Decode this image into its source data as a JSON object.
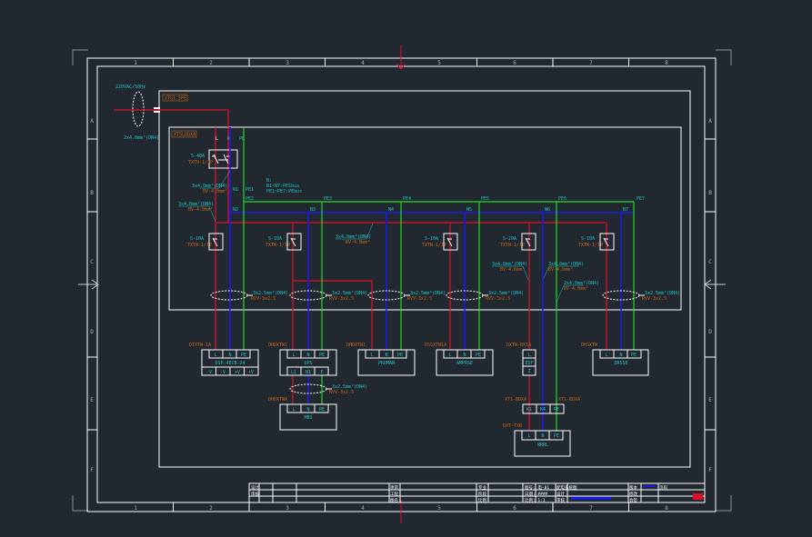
{
  "frame": {
    "columns": [
      "1",
      "2",
      "3",
      "4",
      "5",
      "6",
      "7",
      "8"
    ],
    "rows": [
      "A",
      "B",
      "C",
      "D",
      "E",
      "F"
    ]
  },
  "incoming": {
    "cable_label": "220VAC/50Hz",
    "cable_spec": "2x4.0mm²(DN4)",
    "box_label": "XTS1.5PE",
    "panel_label": "XTSLBDXA"
  },
  "main_switch": {
    "name": "S-40A",
    "spec": "TXTN-1/1P",
    "phase_labels": [
      "L",
      "N",
      "PE"
    ]
  },
  "bus": {
    "note_lines": [
      "N:",
      "N1~N7:PE1bus",
      "PE1~PE7:PEbus"
    ],
    "n_labels": [
      "N1",
      "N2",
      "N3",
      "N4",
      "N5",
      "N6",
      "N7"
    ],
    "pe_labels": [
      "PE1",
      "PE2",
      "PE3",
      "PE4",
      "PE5",
      "PE6",
      "PE7"
    ],
    "wire_notes": [
      {
        "a": "3x4.0mm²(DN4)",
        "b": "BV-4.0mm²"
      },
      {
        "a": "3x4.0mm²(DN4)",
        "b": "BV-4.0mm²"
      },
      {
        "a": "3x4.0mm²(DN4)",
        "b": "BV-4.0mm²"
      },
      {
        "a": "3x4.0mm²(DN4)",
        "b": "BV-4.0mm²"
      },
      {
        "a": "3x4.0mm²(DN4)",
        "b": "BV-4.0mm²"
      },
      {
        "a": "2x4.0mm²(DN4)",
        "b": "BV-4.0mm²"
      }
    ]
  },
  "branches": [
    {
      "breaker": "S-10A",
      "spec": "TXTN-1/1P",
      "cable": "3x2.5mm²(DN4)",
      "cable_spec": "RVV-3x2.5",
      "load": "DTXTN-1A",
      "terminals": [
        "L",
        "N",
        "PE"
      ],
      "device": "DSP-4ECB-24",
      "sub_terminals": [
        "-V",
        "-V",
        "+V",
        "+V"
      ]
    },
    {
      "breaker": "S-10A",
      "spec": "TXTN-1/1P",
      "cable": "3x2.5mm²(DN4)",
      "cable_spec": "RVV-3x2.5",
      "load": "DHDXTN1",
      "terminals": [
        "L",
        "N",
        "PE"
      ],
      "device": "UPS",
      "sub_terminals": [
        "L1",
        "N1",
        "E"
      ]
    },
    {
      "breaker": "",
      "spec": "",
      "cable": "3x2.5mm²(DN4)",
      "cable_spec": "RVV-3x2.5",
      "load": "DHDXTN1",
      "terminals": [
        "L",
        "N",
        "PE"
      ],
      "device": "PROMAN"
    },
    {
      "breaker": "S-10A",
      "spec": "TXTN-1/1P",
      "cable": "3x2.5mm²(DN4)",
      "cable_spec": "RVV-3x2.5",
      "load": "DSSXTN1A",
      "terminals": [
        "L",
        "N",
        "PE"
      ],
      "device": "AMPRSE"
    },
    {
      "breaker": "S-20A",
      "spec": "TXTN-1/1P",
      "load": "DXTN-BX1A",
      "terminals": [
        "L",
        "EDF",
        "Z"
      ],
      "device": ""
    },
    {
      "breaker": "S-10A",
      "spec": "TXTN-1/1P",
      "cable": "3x2.5mm²(DN4)",
      "cable_spec": "RVV-3x2.5",
      "load": "DHSXTN",
      "terminals": [
        "L",
        "N",
        "PE"
      ],
      "device": "DRSSE"
    }
  ],
  "ups_output": {
    "cable": "3x2.5mm²(DN4)",
    "cable_spec": "RVV-3x2.5",
    "load": "DHDXTNA",
    "terminals": [
      "L",
      "N",
      "PE"
    ],
    "device": "MBS"
  },
  "socket": {
    "top_left": "XT1-BDXA",
    "top_right": "XT1-BDXA",
    "mid_terminals": [
      "K1",
      "K4",
      "PE"
    ],
    "load": "DXT-TXB",
    "terminals": [
      "L",
      "N",
      "PE"
    ],
    "device": "NRRL"
  },
  "title_block": {
    "left": [
      "设计",
      "审核"
    ],
    "c1": [
      "项目",
      "工程",
      "图名"
    ],
    "c2": [
      "专业",
      "阶段",
      "比例"
    ],
    "c3": [
      "图号: 电-01",
      "日期: ####",
      "比例: 1:1"
    ],
    "c4": [
      "配电系统图",
      "设计",
      "审核"
    ],
    "c5": [
      "版本",
      "修改",
      "会签"
    ],
    "c6": [
      "页码"
    ],
    "accent_blue": "#1a1ae8",
    "accent_red": "#e0102a"
  },
  "colors": {
    "background": "#212830",
    "phase_L": "#e0102a",
    "neutral_N": "#1a1ae8",
    "earth_PE": "#22dd22",
    "label_cyan": "#1fc4c4",
    "label_orange": "#c86414"
  }
}
